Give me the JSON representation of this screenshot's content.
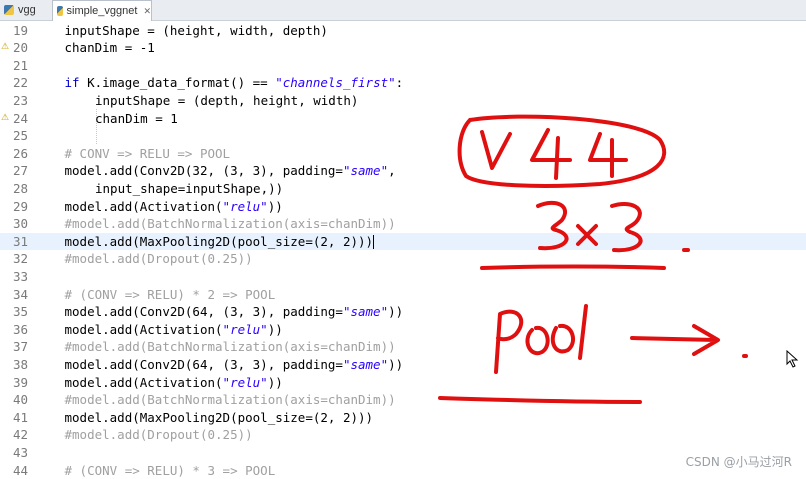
{
  "tabs": [
    {
      "label": "vgg",
      "active": false
    },
    {
      "label": "simple_vggnet",
      "active": true,
      "close": "✕"
    }
  ],
  "lines": [
    {
      "n": "19",
      "parts": [
        [
          "plain",
          "inputShape = (height, width, depth)"
        ]
      ],
      "indent": 1
    },
    {
      "n": "20",
      "parts": [
        [
          "plain",
          "chanDim = -1"
        ]
      ],
      "indent": 1,
      "warn": true
    },
    {
      "n": "21",
      "parts": [],
      "indent": 1
    },
    {
      "n": "22",
      "parts": [
        [
          "kw",
          "if"
        ],
        [
          "plain",
          " K.image_data_format() == "
        ],
        [
          "str",
          "\"channels_first\""
        ],
        [
          "plain",
          ":"
        ]
      ],
      "indent": 1
    },
    {
      "n": "23",
      "parts": [
        [
          "plain",
          "inputShape = (depth, height, width)"
        ]
      ],
      "indent": 2
    },
    {
      "n": "24",
      "parts": [
        [
          "plain",
          "chanDim = 1"
        ]
      ],
      "indent": 2,
      "warn": true
    },
    {
      "n": "25",
      "parts": [],
      "indent": 1
    },
    {
      "n": "26",
      "parts": [
        [
          "cm",
          "# CONV => RELU => POOL"
        ]
      ],
      "indent": 1
    },
    {
      "n": "27",
      "parts": [
        [
          "plain",
          "model.add(Conv2D(32, (3, 3), padding="
        ],
        [
          "str",
          "\"same\""
        ],
        [
          "plain",
          ","
        ]
      ],
      "indent": 1
    },
    {
      "n": "28",
      "parts": [
        [
          "plain",
          "input_shape=inputShape,))"
        ]
      ],
      "indent": 2
    },
    {
      "n": "29",
      "parts": [
        [
          "plain",
          "model.add(Activation("
        ],
        [
          "str",
          "\"relu\""
        ],
        [
          "plain",
          "))"
        ]
      ],
      "indent": 1
    },
    {
      "n": "30",
      "parts": [
        [
          "cm",
          "#model.add(BatchNormalization(axis=chanDim))"
        ]
      ],
      "indent": 1
    },
    {
      "n": "31",
      "parts": [
        [
          "plain",
          "model.add(MaxPooling2D(pool_size=(2, 2)))"
        ]
      ],
      "indent": 1,
      "current": true
    },
    {
      "n": "32",
      "parts": [
        [
          "cm",
          "#model.add(Dropout(0.25))"
        ]
      ],
      "indent": 1
    },
    {
      "n": "33",
      "parts": [],
      "indent": 1
    },
    {
      "n": "34",
      "parts": [
        [
          "cm",
          "# (CONV => RELU) * 2 => POOL"
        ]
      ],
      "indent": 1
    },
    {
      "n": "35",
      "parts": [
        [
          "plain",
          "model.add(Conv2D(64, (3, 3), padding="
        ],
        [
          "str",
          "\"same\""
        ],
        [
          "plain",
          "))"
        ]
      ],
      "indent": 1
    },
    {
      "n": "36",
      "parts": [
        [
          "plain",
          "model.add(Activation("
        ],
        [
          "str",
          "\"relu\""
        ],
        [
          "plain",
          "))"
        ]
      ],
      "indent": 1
    },
    {
      "n": "37",
      "parts": [
        [
          "cm",
          "#model.add(BatchNormalization(axis=chanDim))"
        ]
      ],
      "indent": 1
    },
    {
      "n": "38",
      "parts": [
        [
          "plain",
          "model.add(Conv2D(64, (3, 3), padding="
        ],
        [
          "str",
          "\"same\""
        ],
        [
          "plain",
          "))"
        ]
      ],
      "indent": 1
    },
    {
      "n": "39",
      "parts": [
        [
          "plain",
          "model.add(Activation("
        ],
        [
          "str",
          "\"relu\""
        ],
        [
          "plain",
          "))"
        ]
      ],
      "indent": 1
    },
    {
      "n": "40",
      "parts": [
        [
          "cm",
          "#model.add(BatchNormalization(axis=chanDim))"
        ]
      ],
      "indent": 1
    },
    {
      "n": "41",
      "parts": [
        [
          "plain",
          "model.add(MaxPooling2D(pool_size=(2, 2)))"
        ]
      ],
      "indent": 1
    },
    {
      "n": "42",
      "parts": [
        [
          "cm",
          "#model.add(Dropout(0.25))"
        ]
      ],
      "indent": 1
    },
    {
      "n": "43",
      "parts": [],
      "indent": 1
    },
    {
      "n": "44",
      "parts": [
        [
          "cm",
          "# (CONV => RELU) * 3 => POOL"
        ]
      ],
      "indent": 1
    }
  ],
  "watermark": "CSDN @小马过河R",
  "colors": {
    "string": "#2a00ff",
    "comment": "#a0a0a0",
    "keyword": "#0000c8",
    "ink": "#e01010",
    "current_line": "#e8f2fe"
  }
}
